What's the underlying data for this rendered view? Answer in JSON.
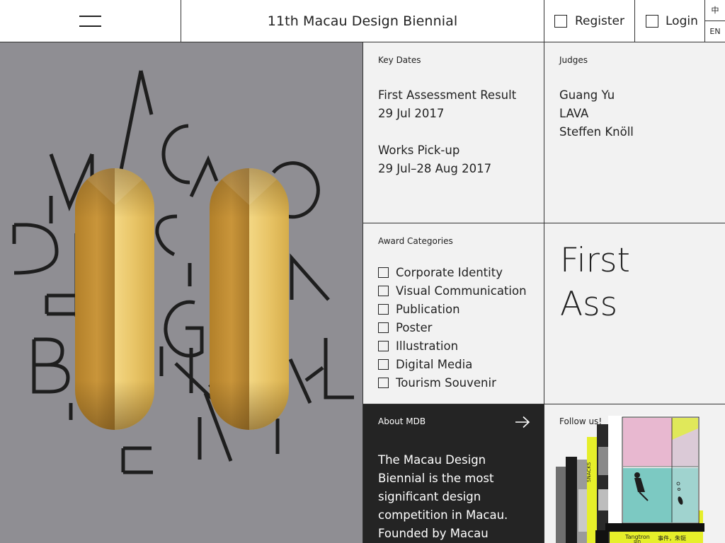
{
  "header": {
    "title": "11th Macau Design Biennial",
    "register_label": "Register",
    "login_label": "Login",
    "lang_zh": "中",
    "lang_en": "EN"
  },
  "hero": {
    "letters": "MACAO DESIGN BIENNAL",
    "logo_numeral": "11",
    "colors": {
      "background": "#8f8e93",
      "gold": "#d8b050"
    }
  },
  "key_dates": {
    "label": "Key Dates",
    "items": [
      {
        "name": "First Assessment Result",
        "date": "29 Jul 2017"
      },
      {
        "name": "Works Pick-up",
        "date": "29 Jul–28 Aug 2017"
      }
    ]
  },
  "judges": {
    "label": "Judges",
    "names": [
      "Guang Yu",
      "LAVA",
      "Steffen Knöll"
    ]
  },
  "awards": {
    "label": "Award Categories",
    "categories": [
      "Corporate Identity",
      "Visual Communication",
      "Publication",
      "Poster",
      "Illustration",
      "Digital Media",
      "Tourism Souvenir"
    ]
  },
  "feature": {
    "line1": "First",
    "line2": "Ass"
  },
  "about": {
    "label": "About MDB",
    "body_lines": [
      "The Macau Design",
      "Biennial is the most",
      "significant design",
      "competition in Macau.",
      "Founded by Macau"
    ],
    "arrow_icon": "arrow-right-icon"
  },
  "follow": {
    "label": "Follow us!",
    "snippets": {
      "snacks": "SNACKS",
      "tangtrong": "Tangtron",
      "sin": "sin",
      "cjk": "事件，朱铤"
    }
  }
}
